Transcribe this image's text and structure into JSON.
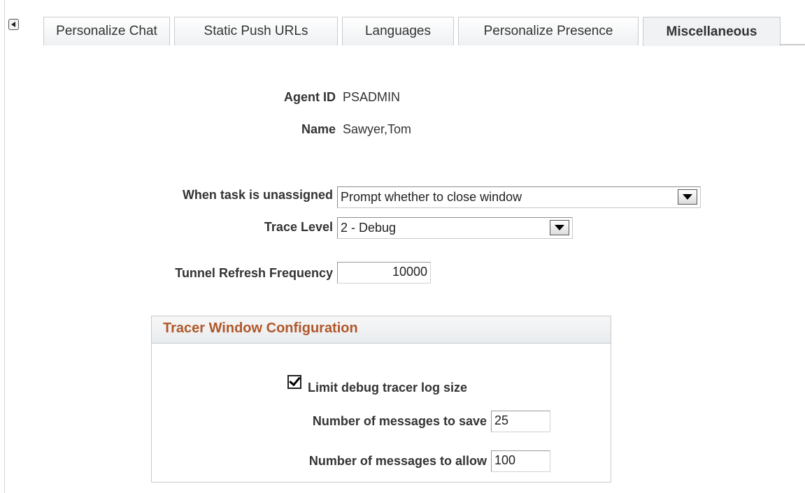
{
  "tabs": [
    {
      "label": "Personalize Chat",
      "active": false
    },
    {
      "label": "Static Push URLs",
      "active": false
    },
    {
      "label": "Languages",
      "active": false
    },
    {
      "label": "Personalize Presence",
      "active": false
    },
    {
      "label": "Miscellaneous",
      "active": true
    }
  ],
  "agent": {
    "id_label": "Agent ID",
    "id_value": "PSADMIN",
    "name_label": "Name",
    "name_value": "Sawyer,Tom"
  },
  "settings": {
    "unassigned_label": "When task is unassigned",
    "unassigned_value": "Prompt whether to close window",
    "trace_label": "Trace Level",
    "trace_value": "2 - Debug",
    "tunnel_label": "Tunnel Refresh Frequency",
    "tunnel_value": "10000"
  },
  "tracer": {
    "title": "Tracer Window Configuration",
    "limit_label": "Limit debug tracer log size",
    "limit_checked": true,
    "save_label": "Number of messages to save",
    "save_value": "25",
    "allow_label": "Number of messages to allow",
    "allow_value": "100"
  },
  "icons": {
    "scroll_left": "arrow-left-icon",
    "dropdown": "chevron-down-icon",
    "checkbox": "checkmark-icon"
  },
  "colors": {
    "group_title": "#b0582a",
    "tab_border": "#c7cbce"
  }
}
